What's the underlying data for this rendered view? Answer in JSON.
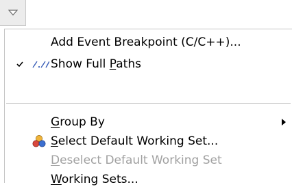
{
  "icons": {
    "dropdown": "view-menu-triangle-icon",
    "check": "checkmark-icon",
    "paths": "full-paths-icon",
    "working_set": "working-set-icon",
    "submenu": "submenu-arrow-icon"
  },
  "menu": {
    "items": [
      {
        "pre": "Add Event Breakpoint (C/C++)...",
        "mn": "",
        "post": ""
      },
      {
        "pre": "Show Full ",
        "mn": "P",
        "post": "aths",
        "checked": true
      },
      {
        "pre": "",
        "mn": "G",
        "post": "roup By",
        "submenu": true
      },
      {
        "pre": "",
        "mn": "S",
        "post": "elect Default Working Set..."
      },
      {
        "pre": "",
        "mn": "D",
        "post": "eselect Default Working Set",
        "disabled": true
      },
      {
        "pre": "",
        "mn": "W",
        "post": "orking Sets..."
      }
    ]
  }
}
